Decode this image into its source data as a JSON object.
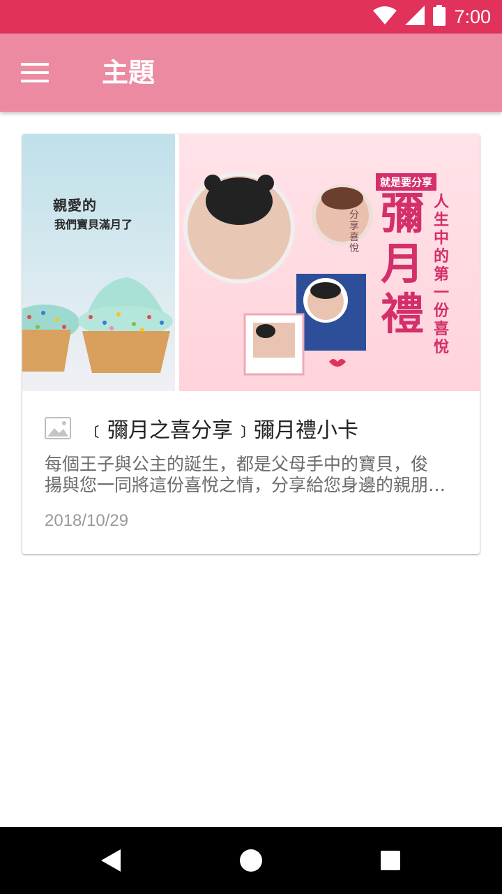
{
  "status_bar": {
    "time": "7:00",
    "icons": [
      "wifi-icon",
      "signal-icon",
      "battery-icon"
    ],
    "color": "#e0325a"
  },
  "app_bar": {
    "title": "主題",
    "menu_icon": "menu-icon",
    "color": "#eb8aa0"
  },
  "card": {
    "image": {
      "left_text_line1": "親愛的",
      "left_text_line2": "我們寶貝滿月了",
      "tag": "就是要分享",
      "big_text": "彌月禮",
      "vertical_text": "人生中的第一份喜悅",
      "small_text": "分享喜悅"
    },
    "title_icon": "image-icon",
    "title": "﹝彌月之喜分享﹞彌月禮小卡",
    "description_line1": "每個王子與公主的誕生，都是父母手中的寶貝，俊",
    "description_line2": "揚與您一同將這份喜悅之情，分享給您身邊的親朋…",
    "date": "2018/10/29"
  },
  "nav_bar": {
    "buttons": [
      "back-icon",
      "home-icon",
      "recents-icon"
    ]
  }
}
